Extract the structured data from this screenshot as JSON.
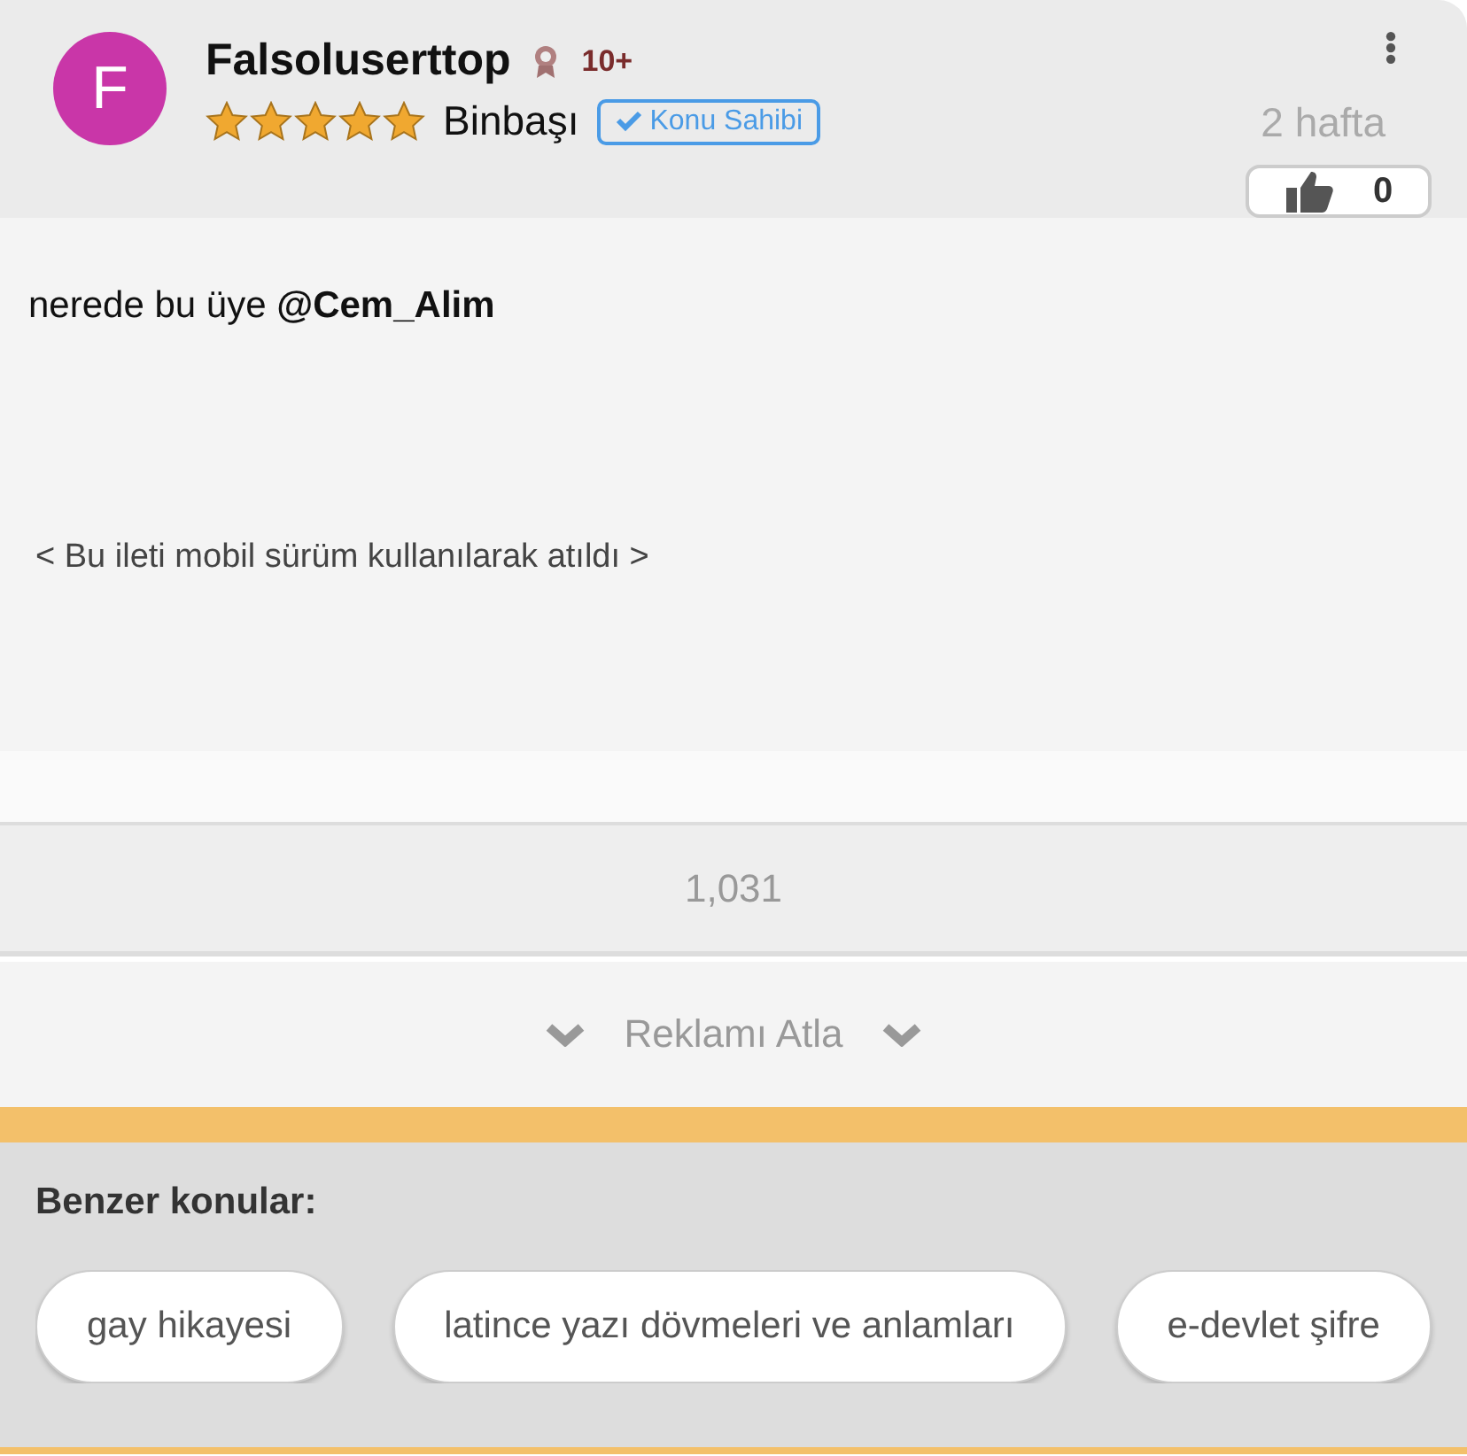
{
  "post": {
    "avatar_letter": "F",
    "username": "Falsoluserttop",
    "badge": "10+",
    "stars": 5,
    "rank": "Binbaşı",
    "owner_tag": "Konu Sahibi",
    "time": "2 hafta",
    "likes": "0",
    "body": "nerede bu üye **@Cem_Alim**",
    "footer_note": "< Bu ileti mobil sürüm kullanılarak atıldı >"
  },
  "views": "1,031",
  "skip_ad": "Reklamı Atla",
  "similar": {
    "title": "Benzer konular:",
    "topics": [
      "gay hikayesi",
      "latince yazı dövmeleri ve anlamları",
      "e-devlet şifre"
    ]
  }
}
